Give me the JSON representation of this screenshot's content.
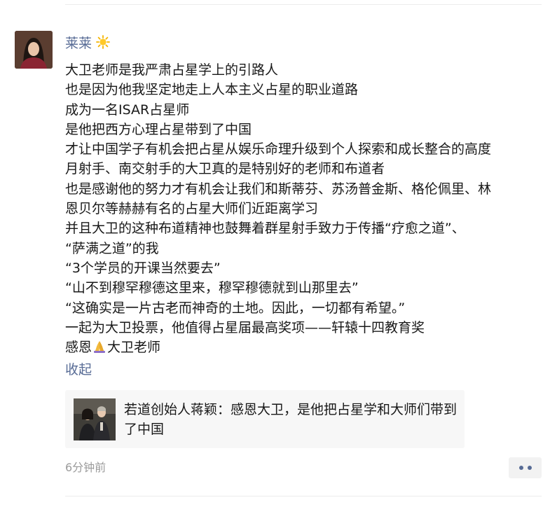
{
  "post": {
    "author": "莱莱",
    "author_emoji_icon": "sun-icon",
    "lines": [
      "大卫老师是我严肃占星学上的引路人",
      "也是因为他我坚定地走上人本主义占星的职业道路",
      "成为一名ISAR占星师",
      "是他把西方心理占星带到了中国",
      "才让中国学子有机会把占星从娱乐命理升级到个人探索和成长整合的高度",
      "月射手、南交射手的大卫真的是特别好的老师和布道者",
      "也是感谢他的努力才有机会让我们和斯蒂芬、苏汤普金斯、格伦佩里、林",
      "恩贝尔等赫赫有名的占星大师们近距离学习",
      "并且大卫的这种布道精神也鼓舞着群星射手致力于传播“疗愈之道”、",
      "“萨满之道”的我",
      "“3个学员的开课当然要去”",
      "“山不到穆罕穆德这里来，穆罕穆德就到山那里去”",
      "“这确实是一片古老而神奇的土地。因此，一切都有希望。”",
      "一起为大卫投票，他值得占星届最高奖项——轩辕十四教育奖"
    ],
    "last_line_before_icon": "感恩",
    "last_line_icon": "praying-hands-icon",
    "last_line_after_icon": "大卫老师",
    "collapse_label": "收起",
    "link_card": {
      "title": "若道创始人蒋颖：感恩大卫，是他把占星学和大师们带到了中国"
    },
    "timestamp": "6分钟前"
  },
  "colors": {
    "link_blue": "#576b95",
    "card_bg": "#f7f7f7",
    "meta_gray": "#9b9b9b"
  }
}
